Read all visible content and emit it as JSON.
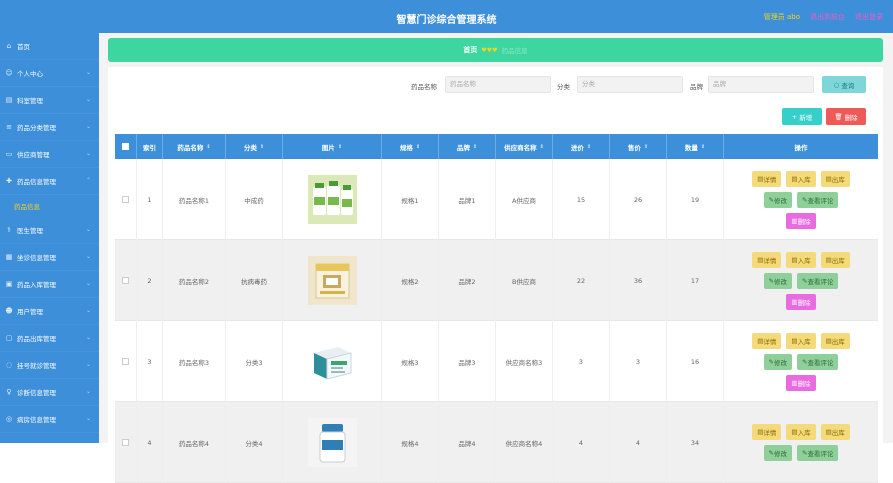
{
  "header": {
    "title": "智慧门诊综合管理系统",
    "admin": "管理员 abo",
    "link_backend": "退出到前台",
    "link_logout": "退出登录"
  },
  "sidebar": {
    "items": [
      {
        "label": "首页",
        "icon": "home-icon"
      },
      {
        "label": "个人中心",
        "icon": "user-icon"
      },
      {
        "label": "科室管理",
        "icon": "building-icon"
      },
      {
        "label": "药品分类管理",
        "icon": "list-icon"
      },
      {
        "label": "供应商管理",
        "icon": "truck-icon"
      },
      {
        "label": "药品信息管理",
        "icon": "pill-icon"
      },
      {
        "label": "医生管理",
        "icon": "doctor-icon"
      },
      {
        "label": "坐诊信息管理",
        "icon": "calendar-icon"
      },
      {
        "label": "药品入库管理",
        "icon": "inbox-icon"
      },
      {
        "label": "用户管理",
        "icon": "users-icon"
      },
      {
        "label": "药品出库管理",
        "icon": "outbox-icon"
      },
      {
        "label": "挂号就诊管理",
        "icon": "ticket-icon"
      },
      {
        "label": "诊断信息管理",
        "icon": "stethoscope-icon"
      },
      {
        "label": "病房信息管理",
        "icon": "bed-icon"
      }
    ],
    "active_sub": "药品信息"
  },
  "breadcrumb": {
    "home": "首页",
    "sep": "♥♥♥",
    "current": "药品信息"
  },
  "search": {
    "name_label": "药品名称",
    "name_placeholder": "药品名称",
    "category_label": "分类",
    "category_placeholder": "分类",
    "brand_label": "品牌",
    "brand_placeholder": "品牌",
    "query_btn": "查询"
  },
  "actions": {
    "new_btn": "新增",
    "delete_btn": "删除"
  },
  "table": {
    "headers": [
      "索引",
      "药品名称",
      "分类",
      "图片",
      "规格",
      "品牌",
      "供应商名称",
      "进价",
      "售价",
      "数量",
      "操作"
    ],
    "rows": [
      {
        "index": "1",
        "name": "药品名称1",
        "category": "中成药",
        "spec": "规格1",
        "brand": "品牌1",
        "supplier": "A供应商",
        "cost": "15",
        "price": "26",
        "qty": "19"
      },
      {
        "index": "2",
        "name": "药品名称2",
        "category": "抗病毒药",
        "spec": "规格2",
        "brand": "品牌2",
        "supplier": "B供应商",
        "cost": "22",
        "price": "36",
        "qty": "17"
      },
      {
        "index": "3",
        "name": "药品名称3",
        "category": "分类3",
        "spec": "规格3",
        "brand": "品牌3",
        "supplier": "供应商名称3",
        "cost": "3",
        "price": "3",
        "qty": "16"
      },
      {
        "index": "4",
        "name": "药品名称4",
        "category": "分类4",
        "spec": "规格4",
        "brand": "品牌4",
        "supplier": "供应商名称4",
        "cost": "4",
        "price": "4",
        "qty": "34"
      }
    ],
    "ops": {
      "detail": "详情",
      "in": "入库",
      "out": "出库",
      "edit": "修改",
      "review": "查看评论",
      "del": "删除"
    }
  },
  "colors": {
    "primary": "#3d8fda",
    "breadcrumb": "#3ed6a0",
    "accent_yellow": "#f5d31b"
  }
}
